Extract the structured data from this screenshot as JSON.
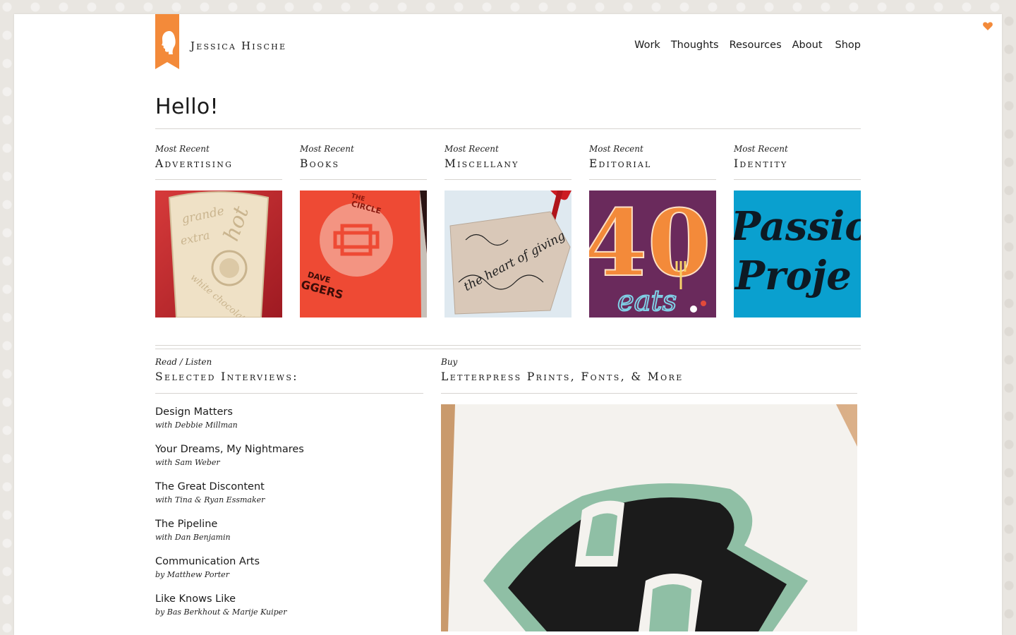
{
  "brand": {
    "name": "Jessica Hische",
    "accent": "#f38a3a"
  },
  "nav": {
    "items": [
      {
        "label": "Work"
      },
      {
        "label": "Thoughts"
      },
      {
        "label": "Resources"
      },
      {
        "label": "About"
      },
      {
        "label": "Shop"
      }
    ]
  },
  "page_title": "Hello!",
  "categories": [
    {
      "kicker": "Most Recent",
      "title": "Advertising",
      "thumb_text": [
        "grande",
        "extra",
        "hot",
        "white chocolate"
      ]
    },
    {
      "kicker": "Most Recent",
      "title": "Books",
      "thumb_text": [
        "THE",
        "CIRCLE",
        "DAVE",
        "GGERS"
      ]
    },
    {
      "kicker": "Most Recent",
      "title": "Miscellany",
      "thumb_text": [
        "the heart of giving"
      ]
    },
    {
      "kicker": "Most Recent",
      "title": "Editorial",
      "thumb_text": [
        "40",
        "eats"
      ]
    },
    {
      "kicker": "Most Recent",
      "title": "Identity",
      "thumb_text": [
        "Passio",
        "Proje"
      ]
    }
  ],
  "interviews_section": {
    "kicker": "Read / Listen",
    "title": "Selected Interviews:",
    "items": [
      {
        "title": "Design Matters",
        "byline": "with Debbie Millman"
      },
      {
        "title": "Your Dreams, My Nightmares",
        "byline": "with Sam Weber"
      },
      {
        "title": "The Great Discontent",
        "byline": "with Tina & Ryan Essmaker"
      },
      {
        "title": "The Pipeline",
        "byline": "with Dan Benjamin"
      },
      {
        "title": "Communication Arts",
        "byline": "by Matthew Porter"
      },
      {
        "title": "Like Knows Like",
        "byline": "by Bas Berkhout & Marije Kuiper"
      }
    ]
  },
  "shop_section": {
    "kicker": "Buy",
    "title": "Letterpress Prints, Fonts, & More",
    "image_letter": "B"
  },
  "icons": {
    "corner": "heart-icon",
    "logo": "silhouette-ribbon-icon"
  },
  "colors": {
    "accent_orange": "#f38a3a",
    "identity_blue": "#0aa0cf",
    "books_red": "#ee4a34",
    "editorial_purple": "#6a2a5c",
    "print_green": "#8fbfa5"
  }
}
